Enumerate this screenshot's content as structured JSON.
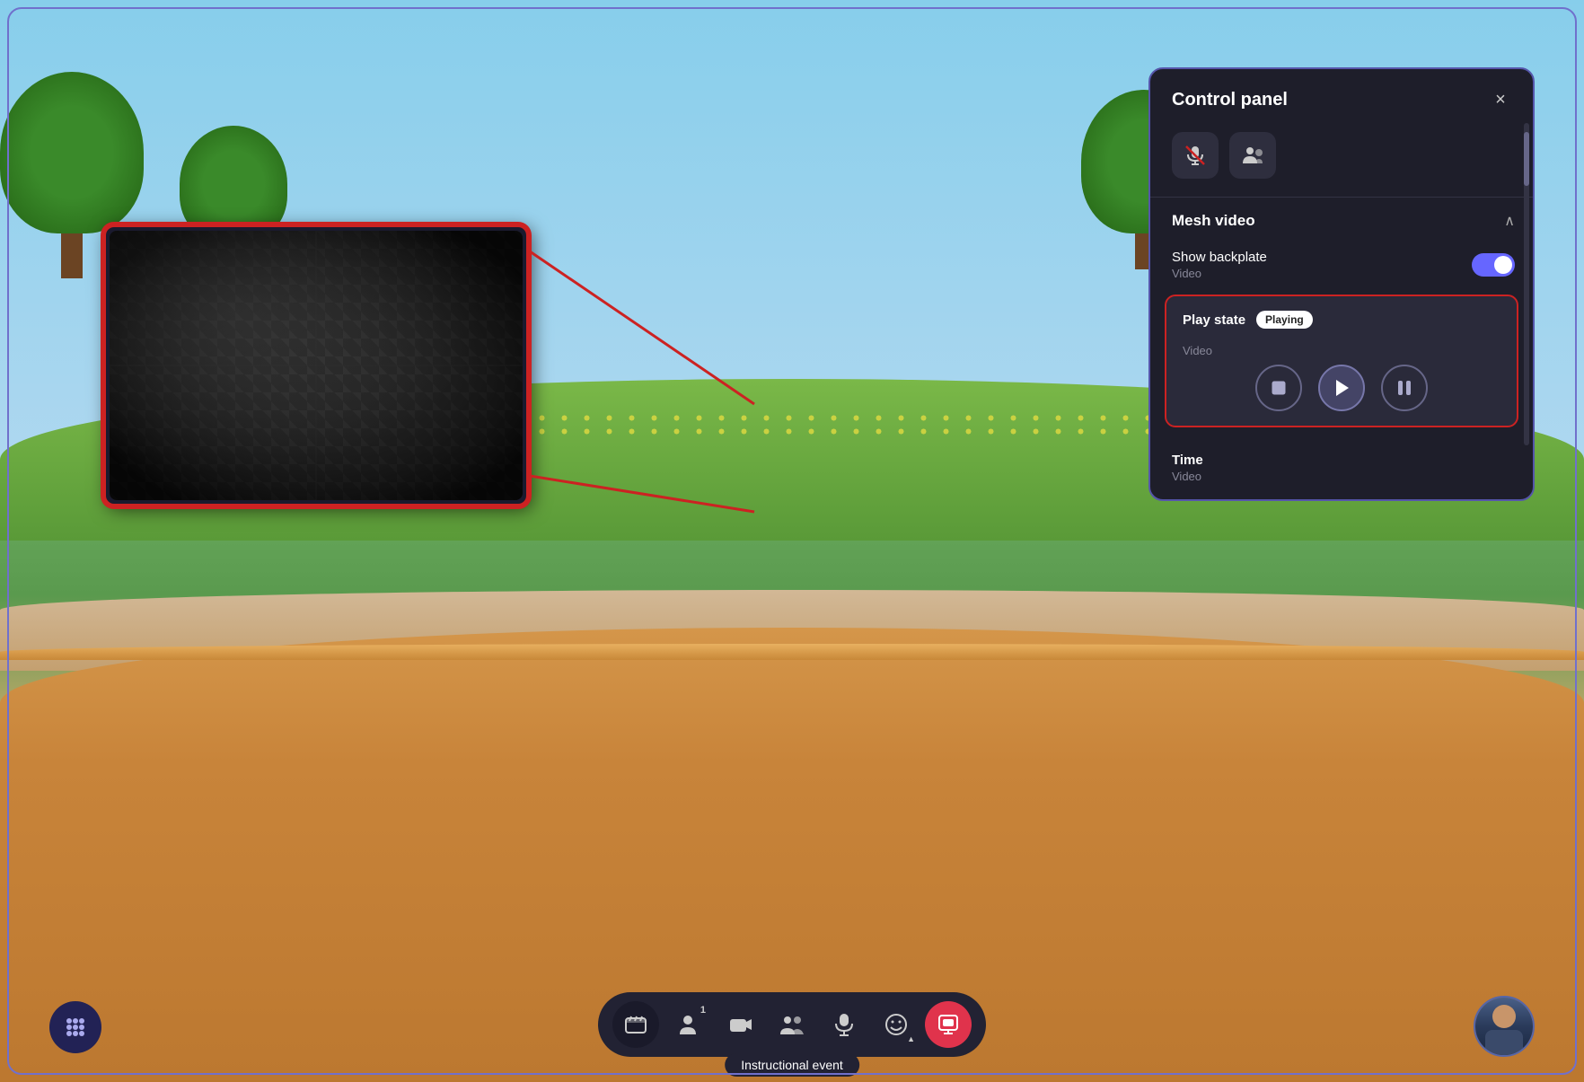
{
  "scene": {
    "background": "3d-virtual-environment"
  },
  "control_panel": {
    "title": "Control panel",
    "close_label": "×",
    "icons": [
      {
        "name": "mic-slash-icon",
        "symbol": "🎤"
      },
      {
        "name": "people-settings-icon",
        "symbol": "👥"
      }
    ],
    "mesh_video_section": {
      "title": "Mesh video",
      "chevron": "^",
      "show_backplate": {
        "label": "Show backplate",
        "sublabel": "Video",
        "toggle_state": "on"
      },
      "play_state": {
        "title": "Play state",
        "sublabel": "Video",
        "badge": "Playing",
        "controls": {
          "stop_label": "■",
          "play_label": "▶",
          "pause_label": "⏸"
        }
      },
      "time": {
        "title": "Time",
        "sublabel": "Video"
      }
    }
  },
  "toolbar": {
    "buttons": [
      {
        "name": "scene-btn",
        "symbol": "🎬",
        "label": ""
      },
      {
        "name": "people-btn",
        "symbol": "👤",
        "count": "1"
      },
      {
        "name": "camera-btn",
        "symbol": "📷",
        "label": ""
      },
      {
        "name": "people-group-btn",
        "symbol": "👥",
        "label": ""
      },
      {
        "name": "mic-btn",
        "symbol": "🎤",
        "label": ""
      },
      {
        "name": "emoji-btn",
        "symbol": "😊",
        "label": ""
      },
      {
        "name": "share-btn",
        "symbol": "⊞",
        "label": "",
        "active": true
      }
    ]
  },
  "event_label": {
    "text": "Instructional event"
  },
  "grid_button": {
    "symbol": "⋮⋮⋮"
  },
  "video_screen": {
    "alt": "Mesh video playing - woven pattern"
  }
}
